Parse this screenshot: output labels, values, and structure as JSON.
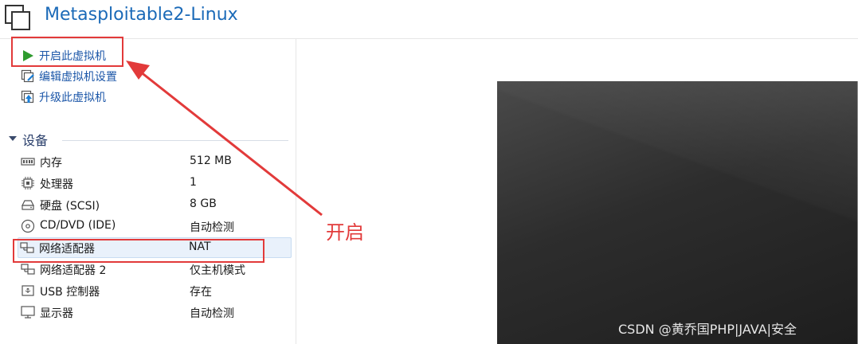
{
  "header": {
    "title": "Metasploitable2-Linux",
    "icon": "vm-window-icon"
  },
  "actions": [
    {
      "label": "开启此虚拟机",
      "icon": "play-icon",
      "color": "#2e9b2e"
    },
    {
      "label": "编辑虚拟机设置",
      "icon": "edit-settings-icon"
    },
    {
      "label": "升级此虚拟机",
      "icon": "upgrade-icon"
    }
  ],
  "devices_section": {
    "title": "设备"
  },
  "devices": [
    {
      "name": "内存",
      "value": "512 MB",
      "icon": "memory-icon"
    },
    {
      "name": "处理器",
      "value": "1",
      "icon": "cpu-icon"
    },
    {
      "name": "硬盘 (SCSI)",
      "value": "8 GB",
      "icon": "harddisk-icon"
    },
    {
      "name": "CD/DVD (IDE)",
      "value": "自动检测",
      "icon": "cd-icon"
    },
    {
      "name": "网络适配器",
      "value": "NAT",
      "icon": "network-adapter-icon",
      "selected": true
    },
    {
      "name": "网络适配器 2",
      "value": "仅主机模式",
      "icon": "network-adapter-icon"
    },
    {
      "name": "USB 控制器",
      "value": "存在",
      "icon": "usb-icon"
    },
    {
      "name": "显示器",
      "value": "自动检测",
      "icon": "monitor-icon"
    }
  ],
  "annotation": {
    "text": "开启",
    "color": "#e23a3a"
  },
  "watermark": "CSDN @黄乔国PHP|JAVA|安全"
}
